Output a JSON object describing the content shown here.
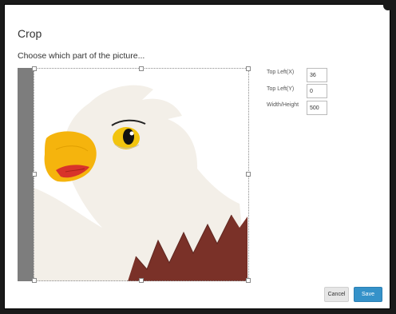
{
  "dialog": {
    "title": "Crop",
    "subtitle": "Choose which part of the picture..."
  },
  "crop": {
    "top_left_x_label": "Top Left(X)",
    "top_left_x_value": "36",
    "top_left_y_label": "Top Left(Y)",
    "top_left_y_value": "0",
    "width_height_label": "Width/Height",
    "width_height_value": "500"
  },
  "footer": {
    "cancel_label": "Cancel",
    "save_label": "Save"
  },
  "colors": {
    "save_button": "#3592c9",
    "beak": "#f5b40d",
    "feathers_brown": "#7a3128"
  }
}
